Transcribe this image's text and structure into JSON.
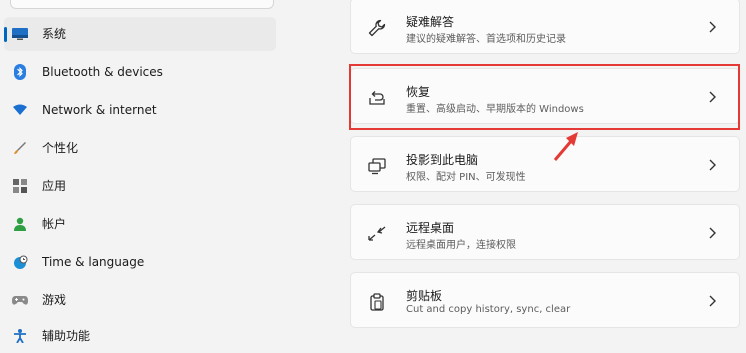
{
  "sidebar": {
    "items": [
      {
        "label": "系统",
        "icon": "monitor-icon",
        "selected": true
      },
      {
        "label": "Bluetooth & devices",
        "icon": "bluetooth-icon"
      },
      {
        "label": "Network & internet",
        "icon": "wifi-icon"
      },
      {
        "label": "个性化",
        "icon": "brush-icon"
      },
      {
        "label": "应用",
        "icon": "apps-icon"
      },
      {
        "label": "帐户",
        "icon": "person-icon"
      },
      {
        "label": "Time & language",
        "icon": "globe-clock-icon"
      },
      {
        "label": "游戏",
        "icon": "gamepad-icon"
      },
      {
        "label": "辅助功能",
        "icon": "accessibility-icon"
      }
    ]
  },
  "main": {
    "cards": [
      {
        "title": "疑难解答",
        "desc": "建议的疑难解答、首选项和历史记录",
        "icon": "wrench-icon"
      },
      {
        "title": "恢复",
        "desc": "重置、高级启动、早期版本的 Windows",
        "icon": "recovery-icon",
        "highlighted": true
      },
      {
        "title": "投影到此电脑",
        "desc": "权限、配对 PIN、可发现性",
        "icon": "project-icon"
      },
      {
        "title": "远程桌面",
        "desc": "远程桌面用户，连接权限",
        "icon": "remote-desktop-icon"
      },
      {
        "title": "剪贴板",
        "desc": "Cut and copy history, sync, clear",
        "icon": "clipboard-icon"
      }
    ]
  },
  "colors": {
    "accent": "#0067c0",
    "highlight": "#e53935",
    "background": "#f3f3f3",
    "card": "#fbfbfb"
  }
}
